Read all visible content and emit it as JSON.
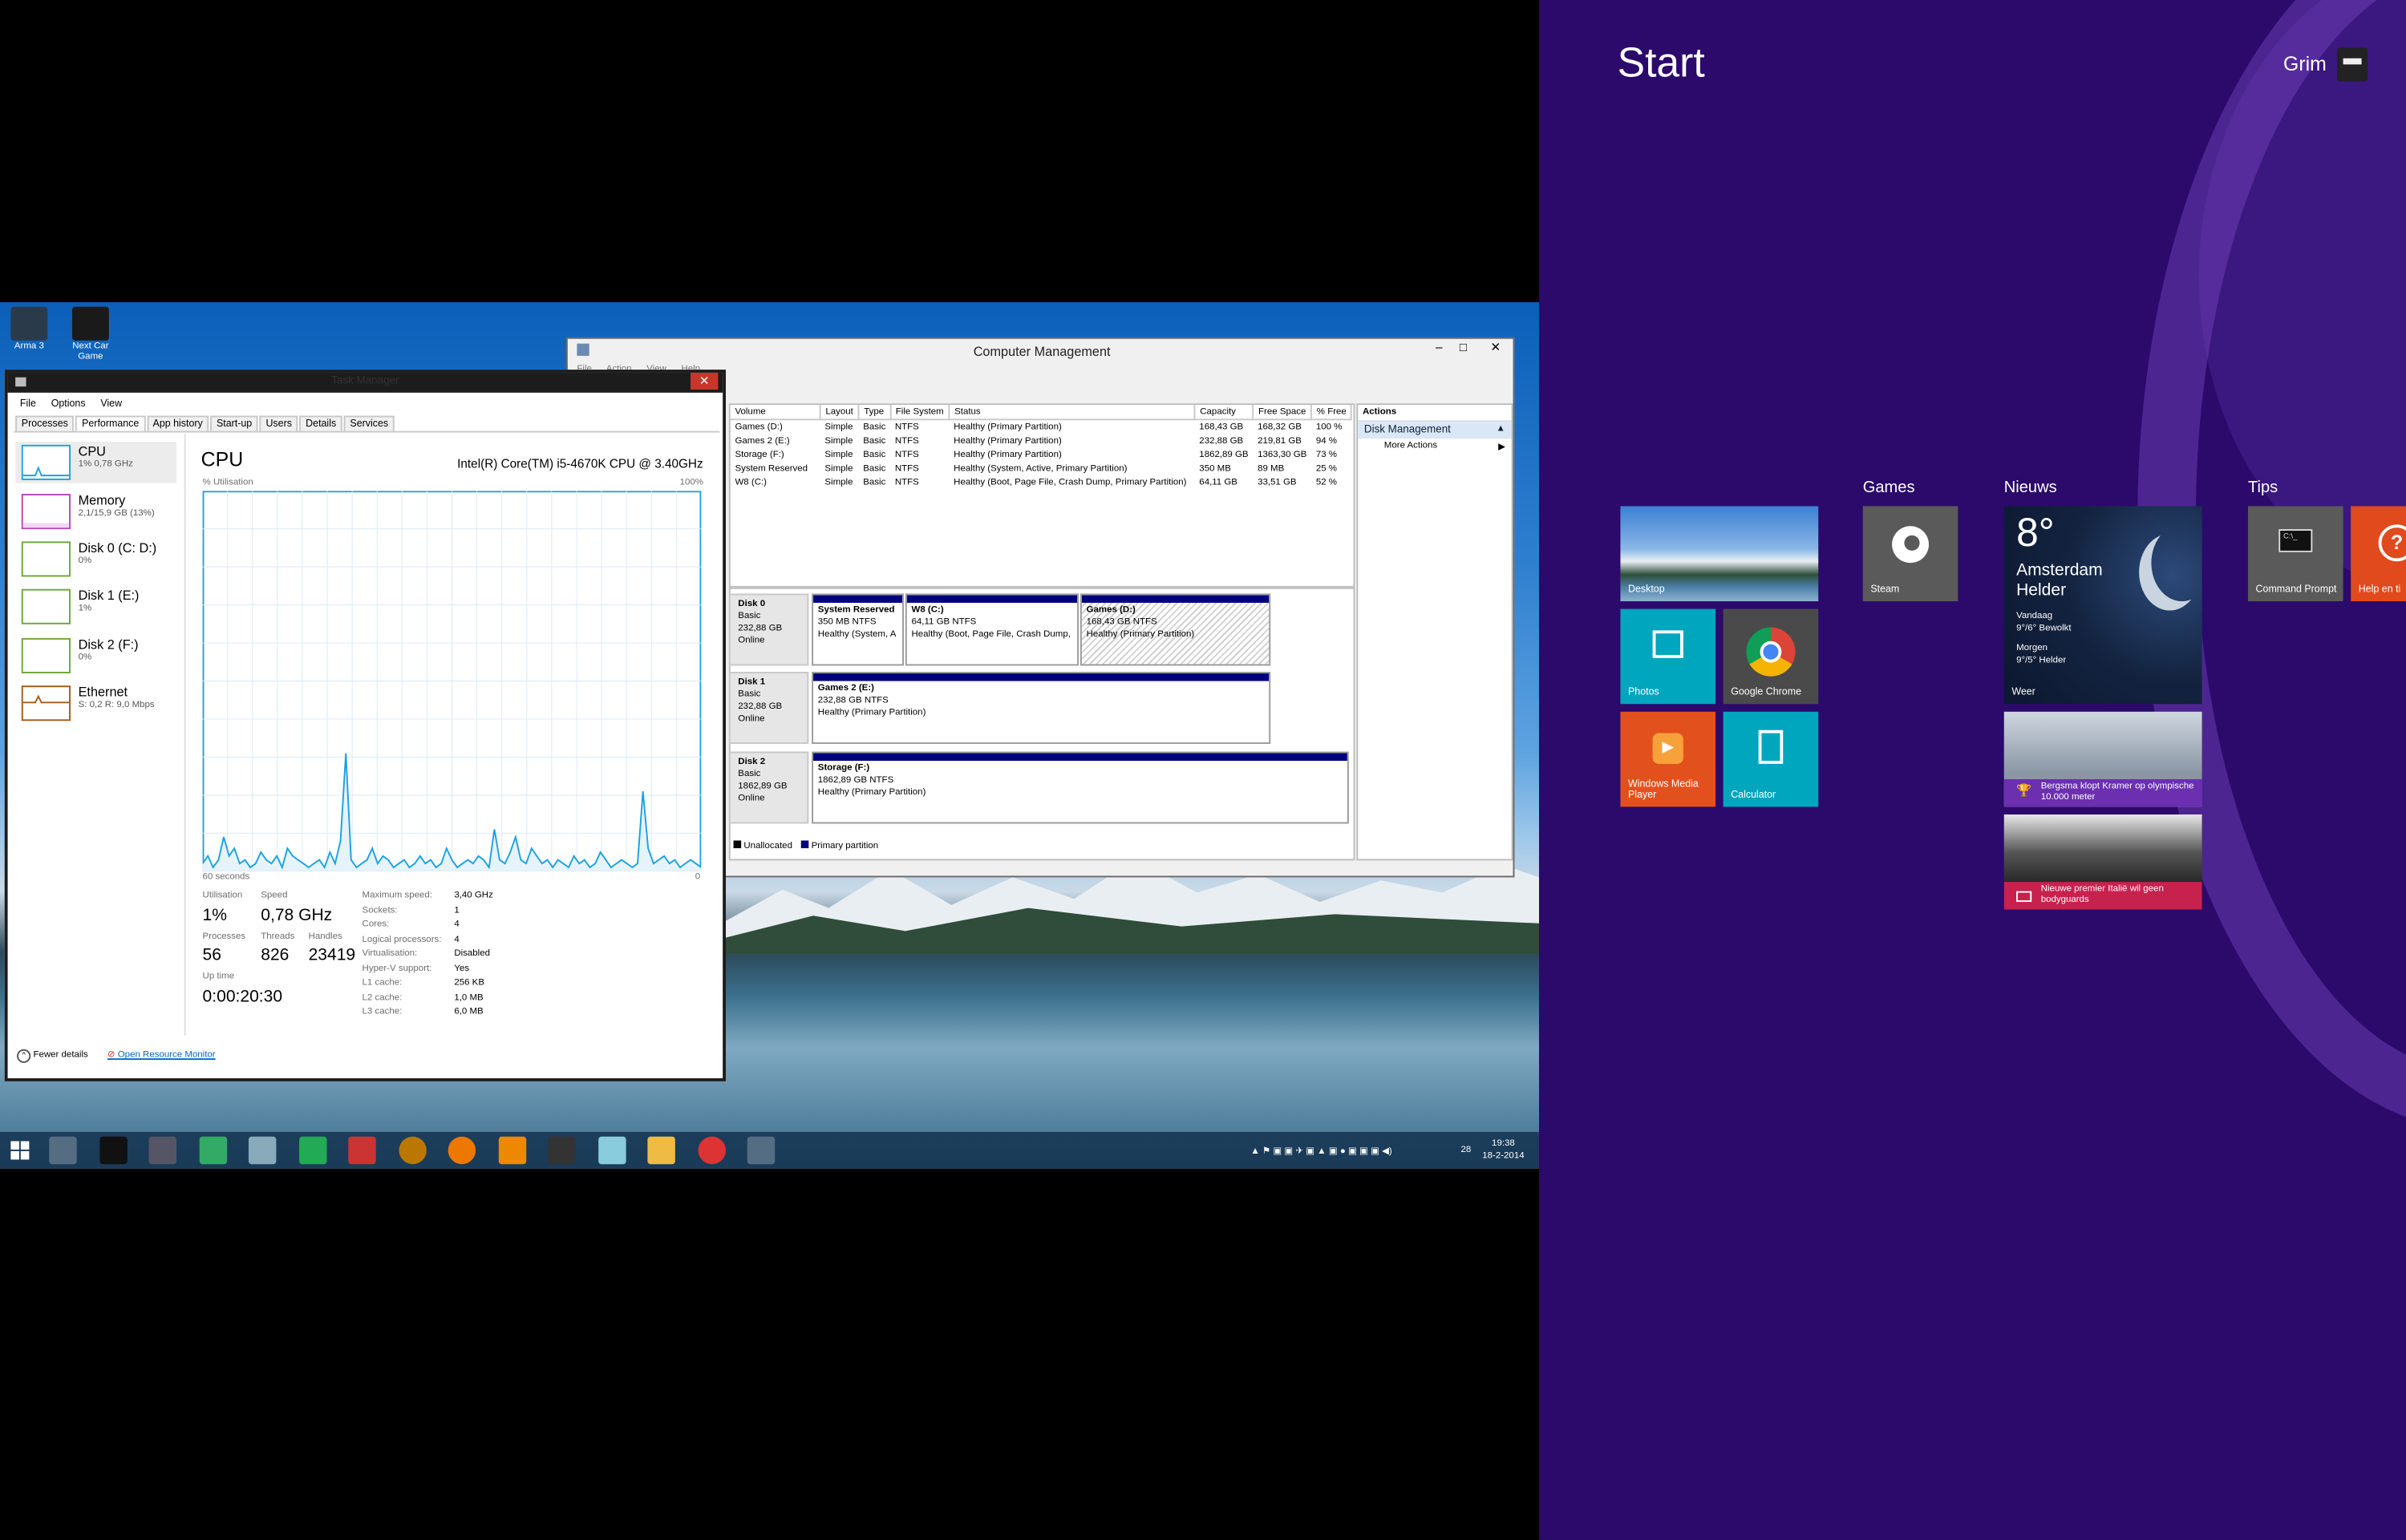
{
  "desktop": {
    "icons": [
      {
        "label": "Arma 3"
      },
      {
        "label": "Next Car Game"
      }
    ]
  },
  "task_manager": {
    "title": "Task Manager",
    "menu": [
      "File",
      "Options",
      "View"
    ],
    "tabs": [
      "Processes",
      "Performance",
      "App history",
      "Start-up",
      "Users",
      "Details",
      "Services"
    ],
    "sidebar": [
      {
        "name": "CPU",
        "detail": "1% 0,78 GHz"
      },
      {
        "name": "Memory",
        "detail": "2,1/15,9 GB (13%)"
      },
      {
        "name": "Disk 0 (C: D:)",
        "detail": "0%"
      },
      {
        "name": "Disk 1 (E:)",
        "detail": "1%"
      },
      {
        "name": "Disk 2 (F:)",
        "detail": "0%"
      },
      {
        "name": "Ethernet",
        "detail": "S: 0,2 R: 9,0 Mbps"
      }
    ],
    "panel": {
      "title": "CPU",
      "cpu_model": "Intel(R) Core(TM) i5-4670K CPU @ 3.40GHz",
      "graph_label": "% Utilisation",
      "graph_max": "100%",
      "graph_time": "60 seconds",
      "graph_min": "0",
      "utilisation_label": "Utilisation",
      "utilisation": "1%",
      "speed_label": "Speed",
      "speed": "0,78 GHz",
      "processes_label": "Processes",
      "processes": "56",
      "threads_label": "Threads",
      "threads": "826",
      "handles_label": "Handles",
      "handles": "23419",
      "uptime_label": "Up time",
      "uptime": "0:00:20:30",
      "specs": [
        {
          "k": "Maximum speed:",
          "v": "3,40 GHz"
        },
        {
          "k": "Sockets:",
          "v": "1"
        },
        {
          "k": "Cores:",
          "v": "4"
        },
        {
          "k": "Logical processors:",
          "v": "4"
        },
        {
          "k": "Virtualisation:",
          "v": "Disabled"
        },
        {
          "k": "Hyper-V support:",
          "v": "Yes"
        },
        {
          "k": "L1 cache:",
          "v": "256 KB"
        },
        {
          "k": "L2 cache:",
          "v": "1,0 MB"
        },
        {
          "k": "L3 cache:",
          "v": "6,0 MB"
        }
      ],
      "cpu_history": [
        2,
        4,
        1,
        3,
        9,
        4,
        6,
        2,
        3,
        1,
        2,
        5,
        3,
        2,
        4,
        1,
        6,
        4,
        3,
        2,
        1,
        2,
        3,
        1,
        5,
        2,
        8,
        31,
        3,
        1,
        2,
        3,
        6,
        2,
        4,
        3,
        1,
        2,
        3,
        1,
        2,
        4,
        2,
        3,
        1,
        2,
        6,
        3,
        1,
        2,
        3,
        2,
        4,
        3,
        1,
        11,
        3,
        2,
        5,
        9,
        3,
        2,
        6,
        4,
        2,
        3,
        1,
        3,
        2,
        1,
        4,
        2,
        3,
        1,
        2,
        5,
        3,
        1,
        2,
        3,
        2,
        1,
        2,
        21,
        6,
        2,
        3,
        4,
        2,
        3,
        1,
        2,
        3,
        2,
        1
      ]
    },
    "footer": {
      "fewer": "Fewer details",
      "resource_monitor": "Open Resource Monitor"
    }
  },
  "computer_management": {
    "title": "Computer Management",
    "menu": [
      "File",
      "Action",
      "View",
      "Help"
    ],
    "columns": [
      "Volume",
      "Layout",
      "Type",
      "File System",
      "Status",
      "Capacity",
      "Free Space",
      "% Free"
    ],
    "rows": [
      [
        "Games (D:)",
        "Simple",
        "Basic",
        "NTFS",
        "Healthy (Primary Partition)",
        "168,43 GB",
        "168,32 GB",
        "100 %"
      ],
      [
        "Games 2 (E:)",
        "Simple",
        "Basic",
        "NTFS",
        "Healthy (Primary Partition)",
        "232,88 GB",
        "219,81 GB",
        "94 %"
      ],
      [
        "Storage (F:)",
        "Simple",
        "Basic",
        "NTFS",
        "Healthy (Primary Partition)",
        "1862,89 GB",
        "1363,30 GB",
        "73 %"
      ],
      [
        "System Reserved",
        "Simple",
        "Basic",
        "NTFS",
        "Healthy (System, Active, Primary Partition)",
        "350 MB",
        "89 MB",
        "25 %"
      ],
      [
        "W8 (C:)",
        "Simple",
        "Basic",
        "NTFS",
        "Healthy (Boot, Page File, Crash Dump, Primary Partition)",
        "64,11 GB",
        "33,51 GB",
        "52 %"
      ]
    ],
    "disks": [
      {
        "name": "Disk 0",
        "type": "Basic",
        "size": "232,88 GB",
        "status": "Online"
      },
      {
        "name": "Disk 1",
        "type": "Basic",
        "size": "232,88 GB",
        "status": "Online"
      },
      {
        "name": "Disk 2",
        "type": "Basic",
        "size": "1862,89 GB",
        "status": "Online"
      }
    ],
    "partitions": [
      {
        "name": "System Reserved",
        "size": "350 MB NTFS",
        "status": "Healthy (System, A"
      },
      {
        "name": "W8  (C:)",
        "size": "64,11 GB NTFS",
        "status": "Healthy (Boot, Page File, Crash Dump,"
      },
      {
        "name": "Games  (D:)",
        "size": "168,43 GB NTFS",
        "status": "Healthy (Primary Partition)"
      },
      {
        "name": "Games 2  (E:)",
        "size": "232,88 GB NTFS",
        "status": "Healthy (Primary Partition)"
      },
      {
        "name": "Storage  (F:)",
        "size": "1862,89 GB NTFS",
        "status": "Healthy (Primary Partition)"
      }
    ],
    "legend": [
      "Unallocated",
      "Primary partition"
    ],
    "actions": {
      "header": "Actions",
      "section": "Disk Management",
      "more": "More Actions"
    }
  },
  "taskbar": {
    "clock_time": "19:38",
    "clock_date": "18-2-2014",
    "tray_count": "28"
  },
  "start": {
    "title": "Start",
    "user": "Grim",
    "groups": [
      "Games",
      "Nieuws",
      "Tips"
    ],
    "tiles": {
      "desktop": "Desktop",
      "photos": "Photos",
      "chrome": "Google Chrome",
      "wmp": "Windows Media Player",
      "calculator": "Calculator",
      "steam": "Steam",
      "cmd": "Command Prompt",
      "help": "Help en ti"
    },
    "weather": {
      "temp": "8°",
      "city": "Amsterdam",
      "cond": "Helder",
      "today_label": "Vandaag",
      "today": "9°/6° Bewolkt",
      "tomorrow_label": "Morgen",
      "tomorrow": "9°/5° Helder",
      "app": "Weer"
    },
    "news": [
      {
        "text": "Bergsma klopt Kramer op olympische 10.000 meter"
      },
      {
        "text": "Nieuwe premier Italië wil geen bodyguards"
      }
    ]
  },
  "colors": {
    "start_bg": "#2b0a6b",
    "tile_teal": "#00a6bd",
    "tile_orange": "#e2511d",
    "tile_gray": "#4a4a4a",
    "tile_red": "#e04a1c",
    "news_purple": "#6b2fb0",
    "news_red": "#c7214e",
    "partition_blue": "#00007d"
  }
}
